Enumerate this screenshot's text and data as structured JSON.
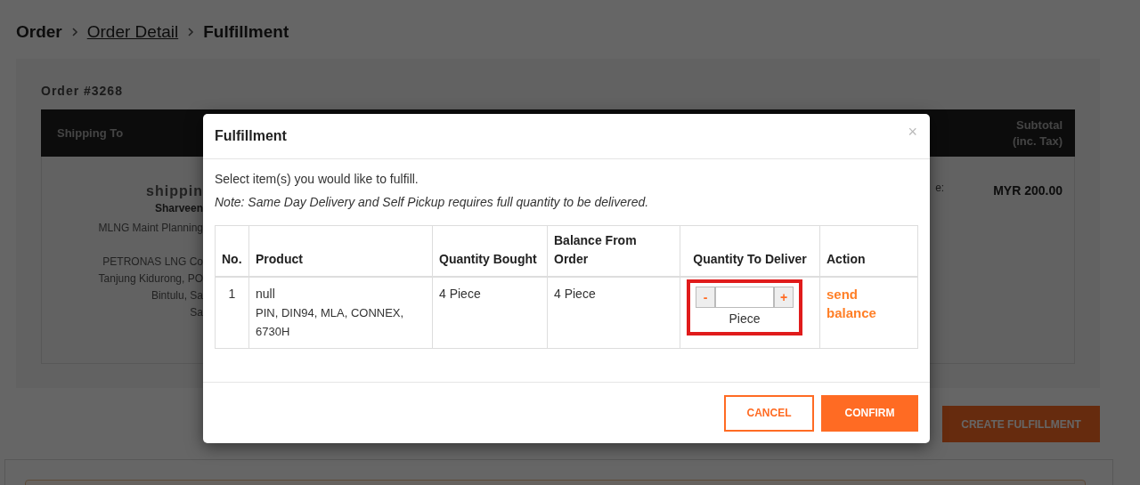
{
  "breadcrumb": [
    {
      "label": "Order",
      "kind": "text"
    },
    {
      "label": "Order Detail",
      "kind": "link"
    },
    {
      "label": "Fulfillment",
      "kind": "text"
    }
  ],
  "order": {
    "title": "Order #3268",
    "columns": [
      "Shipping To",
      "Subtotal (inc. Tax)"
    ],
    "shipping": {
      "heading": "shippin",
      "name": "Sharveen",
      "department": "MLNG Maint Planning",
      "address_lines": [
        "PETRONAS LNG Co",
        "Tanjung Kidurong, PO",
        "Bintulu, Sa",
        "Sa"
      ]
    },
    "column_2_fragment": "e:",
    "subtotal": "MYR 200.00"
  },
  "create_button": "CREATE FULFILLMENT",
  "modal": {
    "title": "Fulfillment",
    "close": "×",
    "intro": "Select item(s) you would like to fulfill.",
    "note": "Note: Same Day Delivery and Self Pickup requires full quantity to be delivered.",
    "columns": [
      "No.",
      "Product",
      "Quantity Bought",
      "Balance From Order",
      "Quantity To Deliver",
      "Action"
    ],
    "rows": [
      {
        "no": "1",
        "product": "null",
        "description": "PIN, DIN94, MLA, CONNEX, 6730H",
        "bought": "4 Piece",
        "balance": "4 Piece",
        "deliver": {
          "minus": "-",
          "plus": "+",
          "unit": "Piece",
          "highlighted": true
        },
        "action": "send balance"
      }
    ],
    "buttons": [
      {
        "label": "CANCEL",
        "kind": "secondary"
      },
      {
        "label": "CONFIRM",
        "kind": "primary"
      }
    ]
  }
}
